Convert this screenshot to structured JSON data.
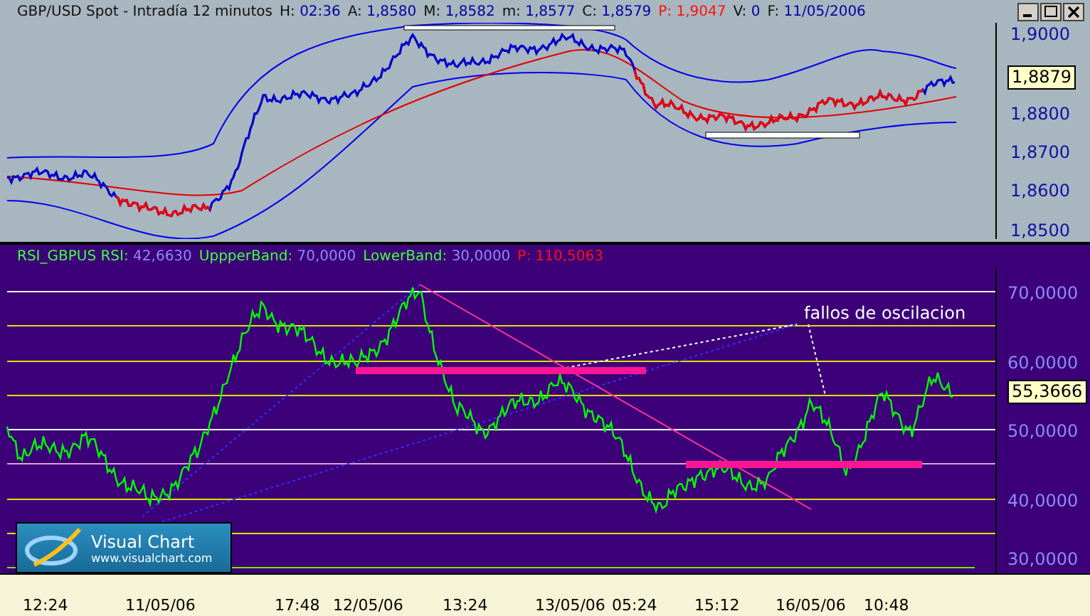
{
  "price_panel": {
    "title": "GBP/USD Spot - Intradía 12 minutos",
    "fields": [
      {
        "label": "H:",
        "value": "02:36",
        "kind": "normal"
      },
      {
        "label": "A:",
        "value": "1,8580",
        "kind": "normal"
      },
      {
        "label": "M:",
        "value": "1,8582",
        "kind": "normal"
      },
      {
        "label": "m:",
        "value": "1,8577",
        "kind": "normal"
      },
      {
        "label": "C:",
        "value": "1,8579",
        "kind": "normal"
      },
      {
        "label": "P:",
        "value": "1,9047",
        "kind": "alert"
      },
      {
        "label": "V:",
        "value": "0",
        "kind": "normal"
      },
      {
        "label": "F:",
        "value": "11/05/2006",
        "kind": "normal"
      }
    ],
    "y_axis": [
      "1,9000",
      "1,8800",
      "1,8700",
      "1,8600",
      "1,8500"
    ],
    "last_price": "1,8879"
  },
  "rsi_panel": {
    "legend": [
      {
        "label": "RSI_GBPUS RSI:",
        "value": "42,6630",
        "kind": "normal"
      },
      {
        "label": "UppperBand:",
        "value": "70,0000",
        "kind": "normal"
      },
      {
        "label": "LowerBand:",
        "value": "30,0000",
        "kind": "normal"
      },
      {
        "label": "P:",
        "value": "110,5063",
        "kind": "alert"
      }
    ],
    "y_axis": [
      "70,0000",
      "60,0000",
      "50,0000",
      "40,0000",
      "30,0000"
    ],
    "last_value": "55,3666",
    "annotation": "fallos de oscilacion"
  },
  "logo": {
    "name": "Visual Chart",
    "url": "www.visualchart.com"
  },
  "time_axis": [
    "12:24",
    "11/05/06",
    "17:48",
    "12/05/06",
    "13:24",
    "13/05/06",
    "05:24",
    "15:12",
    "16/05/06",
    "10:48"
  ]
}
